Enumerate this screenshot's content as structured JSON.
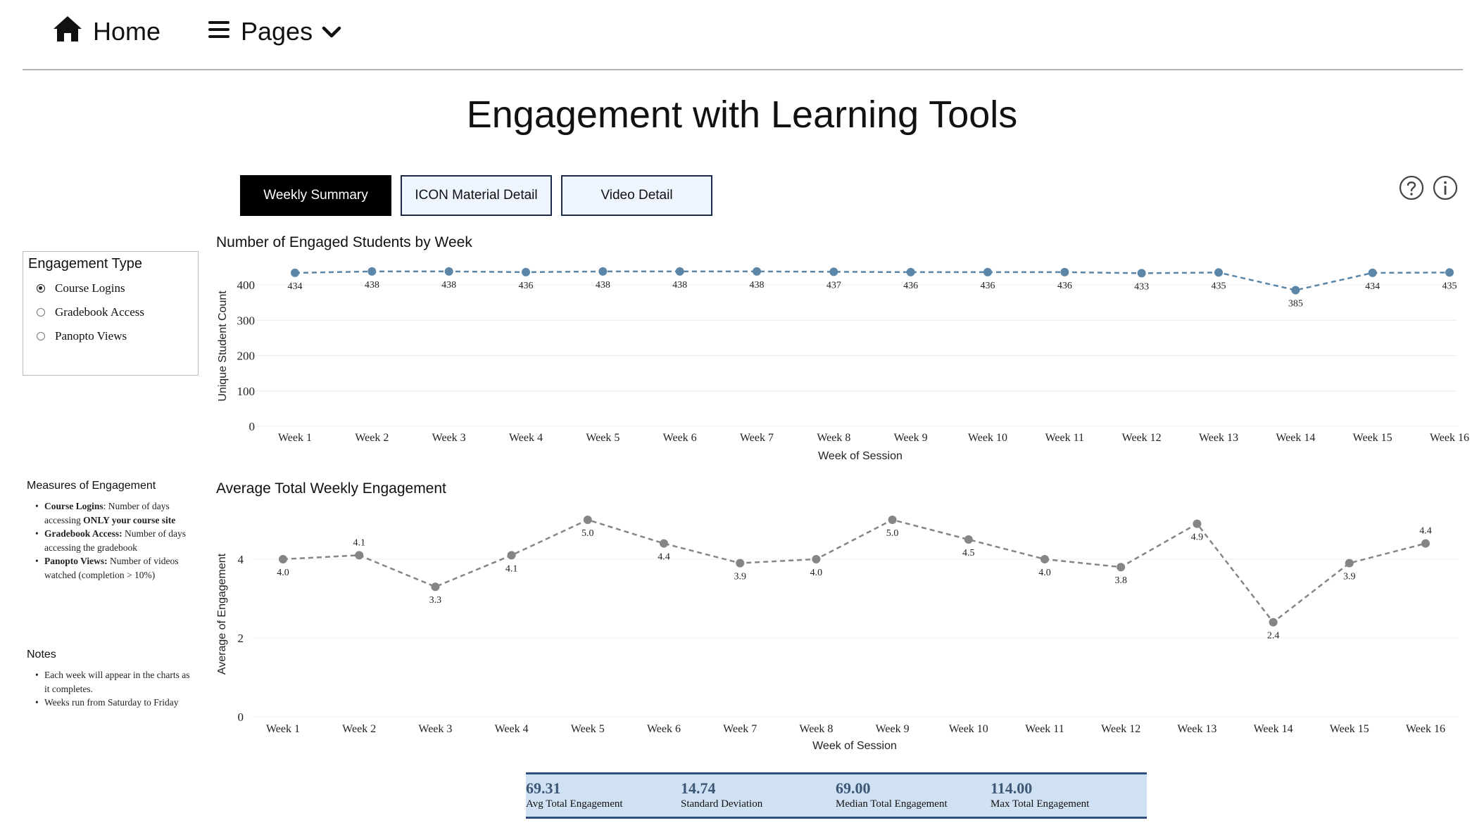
{
  "nav": {
    "home_label": "Home",
    "pages_label": "Pages"
  },
  "page_title": "Engagement with Learning Tools",
  "tabs": [
    {
      "label": "Weekly Summary",
      "active": true
    },
    {
      "label": "ICON Material Detail",
      "active": false
    },
    {
      "label": "Video Detail",
      "active": false
    }
  ],
  "icons": {
    "help": "question-circle-icon",
    "info": "info-circle-icon",
    "home": "home-icon",
    "menu": "hamburger-icon",
    "dropdown": "chevron-down-icon"
  },
  "engagement_type": {
    "title": "Engagement Type",
    "options": [
      {
        "label": "Course Logins",
        "selected": true
      },
      {
        "label": "Gradebook Access",
        "selected": false
      },
      {
        "label": "Panopto Views",
        "selected": false
      }
    ]
  },
  "measures": {
    "title": "Measures of Engagement",
    "items": [
      {
        "term": "Course Logins",
        "desc_before": ": Number of days accessing ",
        "emph": "ONLY your course site"
      },
      {
        "term": "Gradebook Access:",
        "desc_before": " Number of days accessing the gradebook",
        "emph": ""
      },
      {
        "term": "Panopto Views:",
        "desc_before": " Number of videos watched (completion > 10%)",
        "emph": ""
      }
    ]
  },
  "notes": {
    "title": "Notes",
    "items": [
      "Each week will appear in the charts as it completes.",
      "Weeks run from Saturday to Friday"
    ]
  },
  "colors": {
    "series1": "#5b86a8",
    "series2": "#858585",
    "kpi_bg": "#cfe1f3",
    "kpi_border": "#2f4f7f",
    "kpi_value": "#3d5876"
  },
  "chart_data": [
    {
      "type": "line",
      "title": "Number of Engaged Students by Week",
      "xlabel": "Week of Session",
      "ylabel": "Unique Student Count",
      "categories": [
        "Week 1",
        "Week 2",
        "Week 3",
        "Week 4",
        "Week 5",
        "Week 6",
        "Week 7",
        "Week 8",
        "Week 9",
        "Week 10",
        "Week 11",
        "Week 12",
        "Week 13",
        "Week 14",
        "Week 15",
        "Week 16"
      ],
      "values": [
        434,
        438,
        438,
        436,
        438,
        438,
        438,
        437,
        436,
        436,
        436,
        433,
        435,
        385,
        434,
        435
      ],
      "ylim": [
        0,
        400
      ],
      "yticks": [
        0,
        100,
        200,
        300,
        400
      ],
      "grid": true,
      "line_style": "dashed"
    },
    {
      "type": "line",
      "title": "Average Total Weekly Engagement",
      "xlabel": "Week of Session",
      "ylabel": "Average of Engagement",
      "categories": [
        "Week 1",
        "Week 2",
        "Week 3",
        "Week 4",
        "Week 5",
        "Week 6",
        "Week 7",
        "Week 8",
        "Week 9",
        "Week 10",
        "Week 11",
        "Week 12",
        "Week 13",
        "Week 14",
        "Week 15",
        "Week 16"
      ],
      "values": [
        4.0,
        4.1,
        3.3,
        4.1,
        5.0,
        4.4,
        3.9,
        4.0,
        5.0,
        4.5,
        4.0,
        3.8,
        4.9,
        2.4,
        3.9,
        4.4
      ],
      "ylim": [
        0,
        4
      ],
      "yticks": [
        0,
        2,
        4
      ],
      "grid": true,
      "line_style": "dashed"
    }
  ],
  "kpis": [
    {
      "value": "69.31",
      "label": "Avg Total Engagement"
    },
    {
      "value": "14.74",
      "label": "Standard Deviation"
    },
    {
      "value": "69.00",
      "label": "Median Total Engagement"
    },
    {
      "value": "114.00",
      "label": "Max Total Engagement"
    }
  ]
}
